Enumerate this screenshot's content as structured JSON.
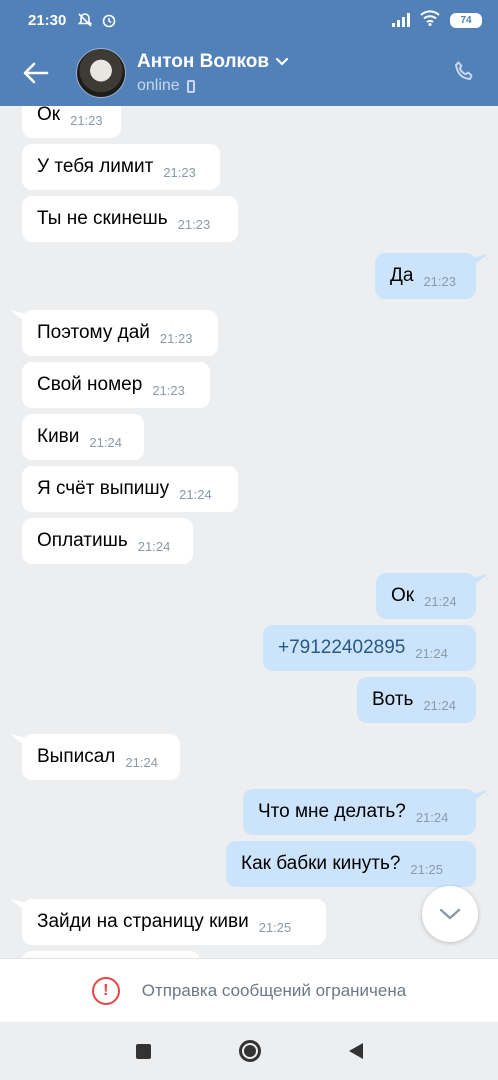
{
  "status_bar": {
    "time": "21:30",
    "battery": "74"
  },
  "contact": {
    "name": "Антон Волков",
    "status": "online"
  },
  "messages": [
    {
      "dir": "in",
      "text": "Ок",
      "time": "21:23"
    },
    {
      "dir": "in",
      "text": "У тебя лимит",
      "time": "21:23"
    },
    {
      "dir": "in",
      "text": "Ты не скинешь",
      "time": "21:23"
    },
    {
      "dir": "out",
      "text": "Да",
      "time": "21:23"
    },
    {
      "dir": "in",
      "text": "Поэтому дай",
      "time": "21:23"
    },
    {
      "dir": "in",
      "text": "Свой номер",
      "time": "21:23"
    },
    {
      "dir": "in",
      "text": "Киви",
      "time": "21:24"
    },
    {
      "dir": "in",
      "text": "Я счёт выпишу",
      "time": "21:24"
    },
    {
      "dir": "in",
      "text": "Оплатишь",
      "time": "21:24"
    },
    {
      "dir": "out",
      "text": "Ок",
      "time": "21:24"
    },
    {
      "dir": "out",
      "text": "+79122402895",
      "time": "21:24"
    },
    {
      "dir": "out",
      "text": "Воть",
      "time": "21:24"
    },
    {
      "dir": "in",
      "text": "Выписал",
      "time": "21:24"
    },
    {
      "dir": "out",
      "text": "Что мне делать?",
      "time": "21:24"
    },
    {
      "dir": "out",
      "text": "Как бабки кинуть?",
      "time": "21:25"
    },
    {
      "dir": "in",
      "text": "Зайди на страницу киви",
      "time": "21:25"
    }
  ],
  "restriction_notice": "Отправка сообщений ограничена",
  "colors": {
    "header": "#5181b8",
    "incoming": "#ffffff",
    "outgoing": "#cce4fb",
    "background": "#edeef0",
    "warning": "#e64646"
  }
}
